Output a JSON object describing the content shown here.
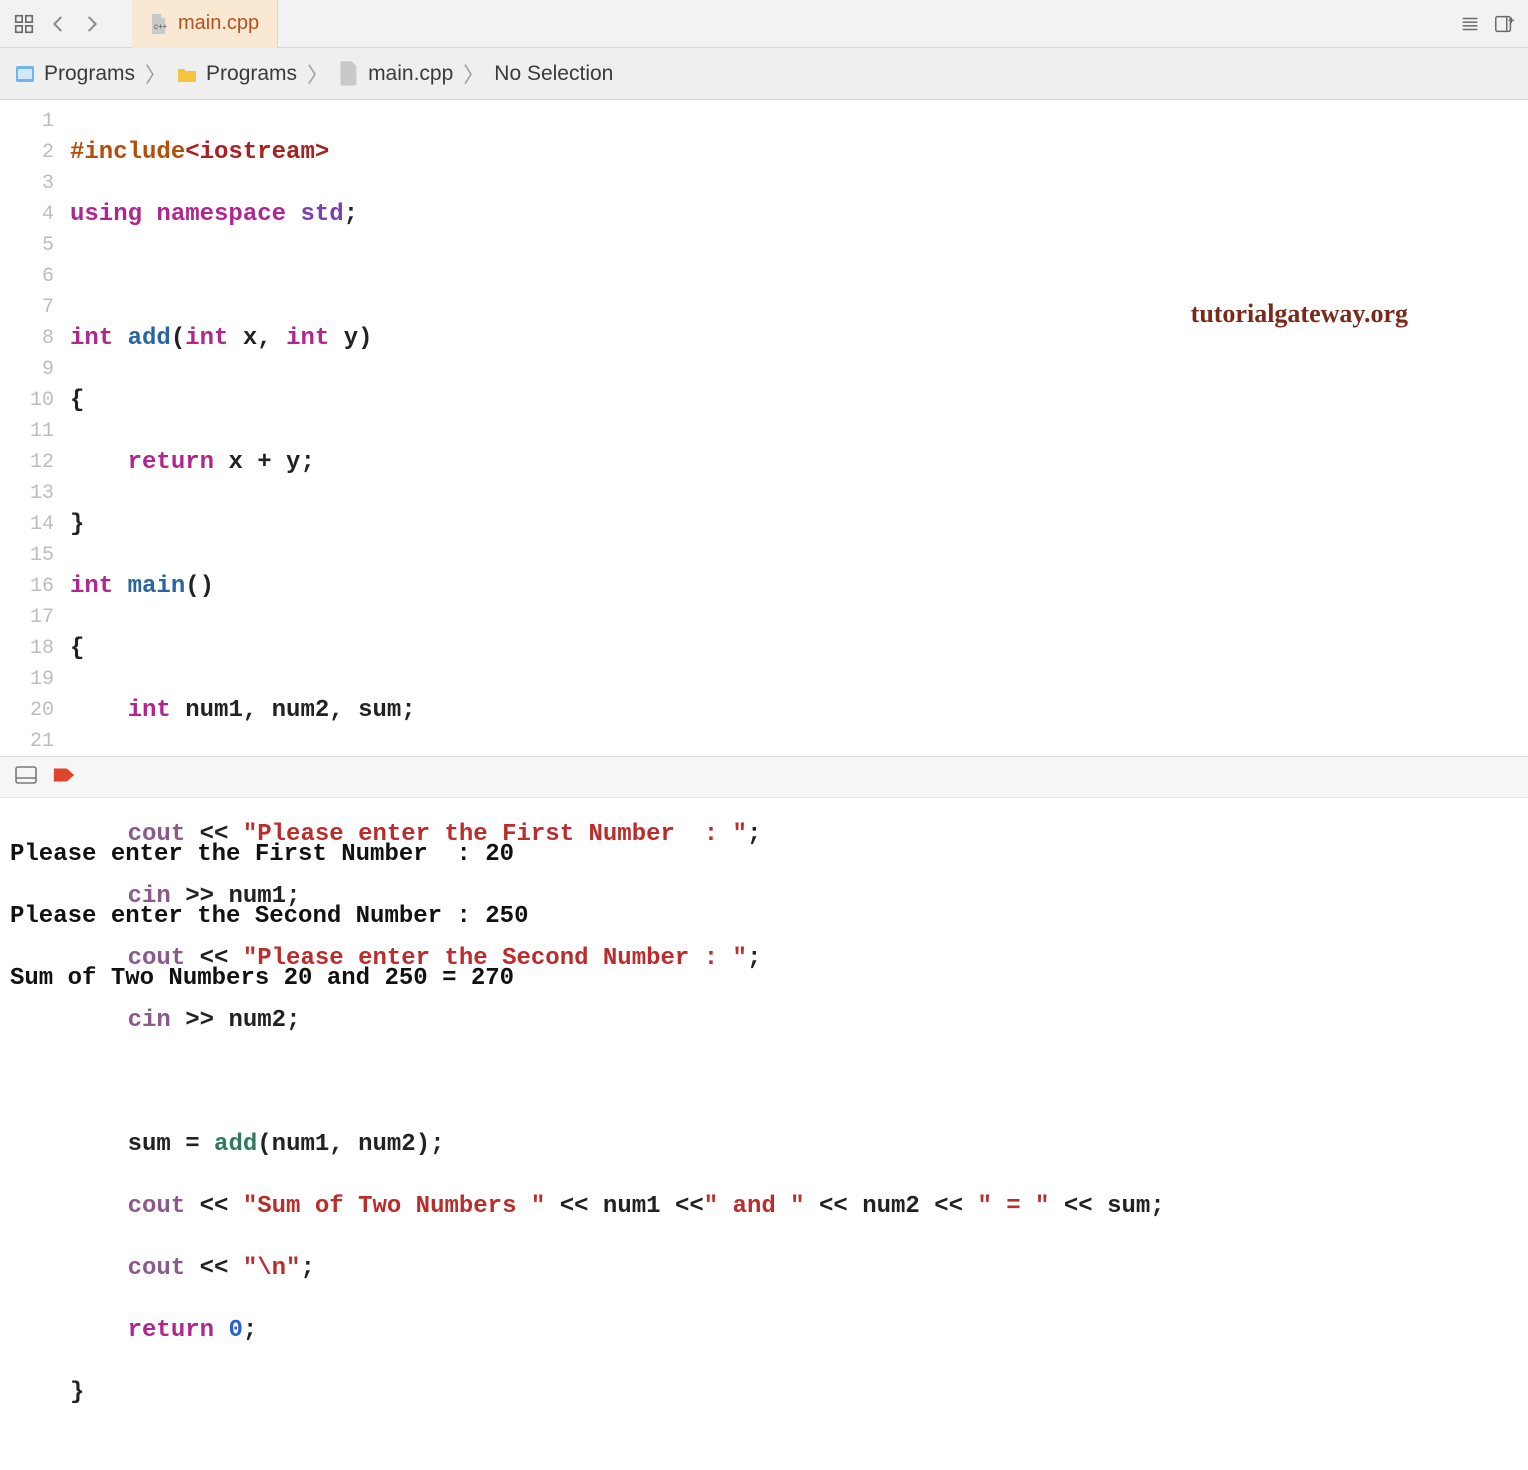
{
  "tab": {
    "filename": "main.cpp"
  },
  "breadcrumb": {
    "items": [
      "Programs",
      "Programs",
      "main.cpp",
      "No Selection"
    ]
  },
  "watermark": "tutorialgateway.org",
  "code": {
    "line_count": 21,
    "tokens": {
      "include": "#include",
      "iostream_hdr": "<iostream>",
      "using": "using",
      "namespace": "namespace",
      "std": "std",
      "int_kw": "int",
      "add_fn": "add",
      "x_param": "x",
      "y_param": "y",
      "return_kw": "return",
      "main_fn": "main",
      "num1": "num1",
      "num2": "num2",
      "sum": "sum",
      "cout": "cout",
      "cin": "cin",
      "str_first": "\"Please enter the First Number  : \"",
      "str_second": "\"Please enter the Second Number : \"",
      "str_sumof": "\"Sum of Two Numbers \"",
      "str_and": "\" and \"",
      "str_eq": "\" = \"",
      "str_nl": "\"\\n\"",
      "zero": "0"
    }
  },
  "console": {
    "lines": [
      "Please enter the First Number  : 20",
      "Please enter the Second Number : 250",
      "Sum of Two Numbers 20 and 250 = 270"
    ]
  },
  "icons": {
    "grid": "grid-icon",
    "back": "chevron-left-icon",
    "forward": "chevron-right-icon",
    "lines": "lines-icon",
    "add_panel": "add-panel-icon",
    "panel": "panel-icon",
    "tag": "tag-icon"
  }
}
